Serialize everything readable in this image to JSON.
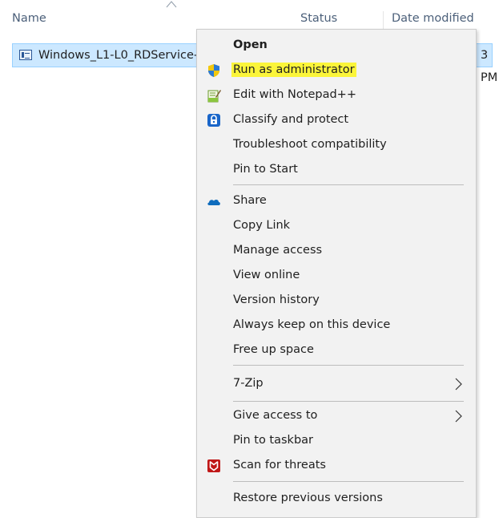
{
  "columns": {
    "name": "Name",
    "status": "Status",
    "date_modified": "Date modified"
  },
  "file": {
    "name": "Windows_L1-L0_RDService-",
    "date_fragment": "3 PM"
  },
  "menu": {
    "open": "Open",
    "run_as_admin": "Run as administrator",
    "edit_notepad": "Edit with Notepad++",
    "classify": "Classify and protect",
    "troubleshoot": "Troubleshoot compatibility",
    "pin_start": "Pin to Start",
    "share": "Share",
    "copy_link": "Copy Link",
    "manage_access": "Manage access",
    "view_online": "View online",
    "version_history": "Version history",
    "always_keep": "Always keep on this device",
    "free_up": "Free up space",
    "seven_zip": "7-Zip",
    "give_access": "Give access to",
    "pin_taskbar": "Pin to taskbar",
    "scan_threats": "Scan for threats",
    "restore_versions": "Restore previous versions"
  },
  "colors": {
    "highlight": "#fbf53a",
    "selection": "#cce8ff",
    "menu_bg": "#f2f2f2"
  }
}
